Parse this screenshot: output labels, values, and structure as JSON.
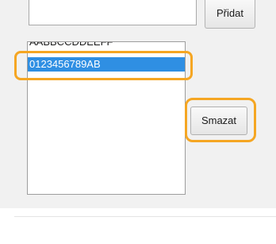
{
  "form": {
    "input_value": "",
    "add_button_label": "Přidat",
    "delete_button_label": "Smazat"
  },
  "list": {
    "items": [
      {
        "label": "AABBCCDDEEFF"
      },
      {
        "label": "0123456789AB"
      }
    ],
    "selected_index": 1
  },
  "highlight_color": "#f5a623",
  "selection_color": "#2f8fe3"
}
